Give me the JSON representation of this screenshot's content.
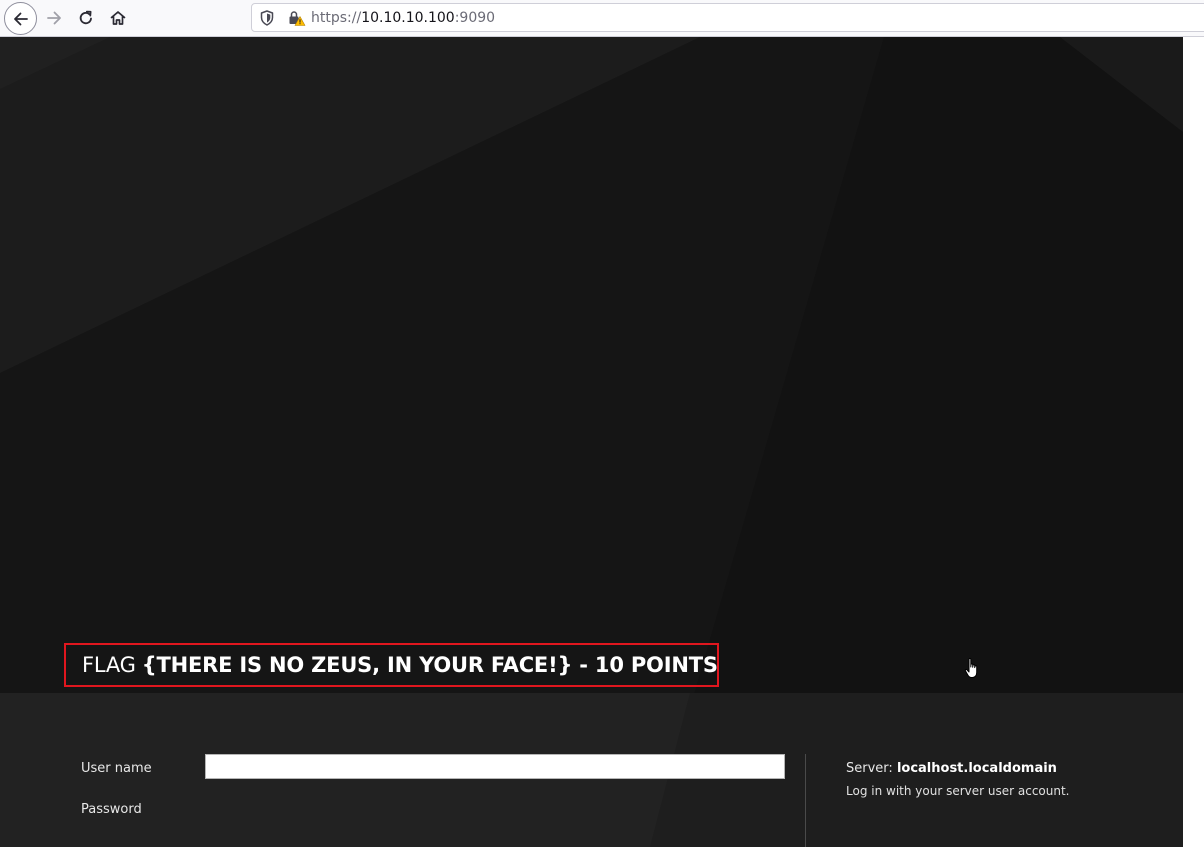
{
  "browser": {
    "url": {
      "scheme": "https://",
      "host": "10.10.10.100",
      "port": ":9090"
    },
    "icons": {
      "back": "arrow-left-icon",
      "forward": "arrow-right-icon",
      "reload": "reload-icon",
      "home": "home-icon",
      "tracking": "shield-icon",
      "security": "lock-warning-icon"
    }
  },
  "flag": {
    "prefix": "FLAG",
    "value": "{THERE IS NO ZEUS, IN YOUR FACE!} - 10 POINTS",
    "border_color": "#e0161e"
  },
  "login": {
    "username_label": "User name",
    "username_value": "",
    "password_label": "Password",
    "server_label": "Server:",
    "server_name": "localhost.localdomain",
    "server_hint": "Log in with your server user account."
  },
  "colors": {
    "page_background": "#151515",
    "panel_background": "#222222"
  }
}
